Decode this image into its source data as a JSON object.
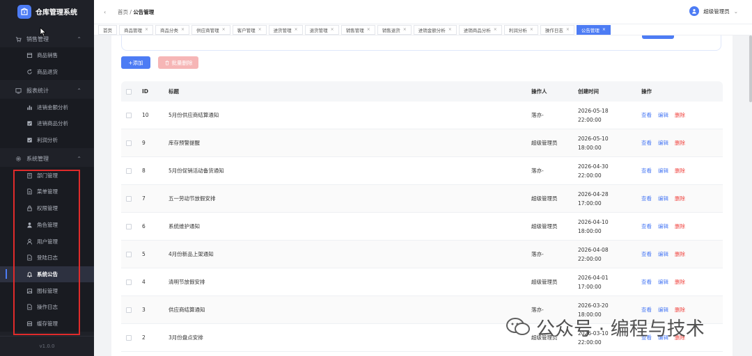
{
  "app": {
    "title": "仓库管理系统",
    "version": "v1.0.0"
  },
  "sidebar": {
    "groups": [
      {
        "label": "销售管理",
        "icon": "cart-icon",
        "items": [
          {
            "label": "商品销售",
            "icon": "box-icon"
          },
          {
            "label": "商品退货",
            "icon": "return-icon"
          }
        ]
      },
      {
        "label": "报表统计",
        "icon": "report-icon",
        "items": [
          {
            "label": "进销金额分析",
            "icon": "bar-chart-icon"
          },
          {
            "label": "进销商品分析",
            "icon": "check-square-icon"
          },
          {
            "label": "利润分析",
            "icon": "check-square-icon"
          }
        ]
      },
      {
        "label": "系统管理",
        "icon": "gear-icon",
        "items": [
          {
            "label": "部门管理",
            "icon": "building-icon"
          },
          {
            "label": "菜单管理",
            "icon": "document-icon"
          },
          {
            "label": "权限管理",
            "icon": "lock-icon"
          },
          {
            "label": "角色管理",
            "icon": "person-filled-icon"
          },
          {
            "label": "用户管理",
            "icon": "person-outline-icon"
          },
          {
            "label": "登陆日志",
            "icon": "file-icon"
          },
          {
            "label": "系统公告",
            "icon": "bell-icon",
            "active": true
          },
          {
            "label": "图标管理",
            "icon": "picture-icon"
          },
          {
            "label": "操作日志",
            "icon": "file-icon"
          },
          {
            "label": "缓存管理",
            "icon": "storage-icon"
          }
        ]
      }
    ]
  },
  "header": {
    "breadcrumb_home": "首页",
    "breadcrumb_sep": "/",
    "breadcrumb_current": "公告管理",
    "user_name": "超级管理员"
  },
  "tabs": [
    {
      "label": "首页",
      "closable": false
    },
    {
      "label": "商品管理",
      "closable": true
    },
    {
      "label": "商品分类",
      "closable": true
    },
    {
      "label": "供应商管理",
      "closable": true
    },
    {
      "label": "客户管理",
      "closable": true
    },
    {
      "label": "进货管理",
      "closable": true
    },
    {
      "label": "退货管理",
      "closable": true
    },
    {
      "label": "销售管理",
      "closable": true
    },
    {
      "label": "销售退货",
      "closable": true
    },
    {
      "label": "进销金额分析",
      "closable": true
    },
    {
      "label": "进销商品分析",
      "closable": true
    },
    {
      "label": "利润分析",
      "closable": true
    },
    {
      "label": "操作日志",
      "closable": true
    },
    {
      "label": "公告管理",
      "closable": true,
      "active": true
    }
  ],
  "toolbar": {
    "add_label": "+添加",
    "batch_delete_label": "批量删除"
  },
  "table": {
    "columns": {
      "id": "ID",
      "title": "标题",
      "operator": "操作人",
      "created": "创建时间",
      "actions": "操作"
    },
    "action_labels": {
      "view": "查看",
      "edit": "编辑",
      "delete": "删除"
    },
    "rows": [
      {
        "id": "10",
        "title": "5月份供应商结算通知",
        "operator": "落亦-",
        "date": "2026-05-18",
        "time": "22:00:00"
      },
      {
        "id": "9",
        "title": "库存预警提醒",
        "operator": "超级管理员",
        "date": "2026-05-10",
        "time": "18:00:00"
      },
      {
        "id": "8",
        "title": "5月份促销活动备货通知",
        "operator": "落亦-",
        "date": "2026-04-30",
        "time": "22:00:00"
      },
      {
        "id": "7",
        "title": "五一劳动节放假安排",
        "operator": "超级管理员",
        "date": "2026-04-28",
        "time": "17:00:00"
      },
      {
        "id": "6",
        "title": "系统维护通知",
        "operator": "超级管理员",
        "date": "2026-04-10",
        "time": "18:00:00"
      },
      {
        "id": "5",
        "title": "4月份新品上架通知",
        "operator": "落亦-",
        "date": "2026-04-08",
        "time": "22:00:00"
      },
      {
        "id": "4",
        "title": "清明节放假安排",
        "operator": "超级管理员",
        "date": "2026-04-01",
        "time": "17:00:00"
      },
      {
        "id": "3",
        "title": "供应商结算通知",
        "operator": "落亦-",
        "date": "2026-03-20",
        "time": "18:00:00"
      },
      {
        "id": "2",
        "title": "3月份盘点安排",
        "operator": "超级管理员",
        "date": "2026-03-10",
        "time": "22:00:00"
      }
    ]
  },
  "watermark": {
    "text": "公众号 · 编程与技术"
  },
  "colors": {
    "primary": "#4d7cf4",
    "danger": "#f0433e",
    "sidebar_bg": "#1f2128",
    "highlight": "#e02b2b"
  }
}
